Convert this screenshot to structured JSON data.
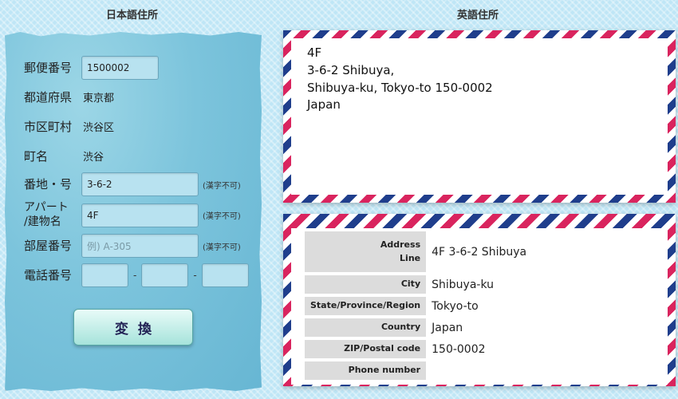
{
  "headings": {
    "japanese": "日本語住所",
    "english": "英語住所"
  },
  "form": {
    "postal_code": {
      "label": "郵便番号",
      "value": "1500002"
    },
    "prefecture": {
      "label": "都道府県",
      "value": "東京都"
    },
    "city": {
      "label": "市区町村",
      "value": "渋谷区"
    },
    "town": {
      "label": "町名",
      "value": "渋谷"
    },
    "block": {
      "label": "番地・号",
      "value": "3-6-2",
      "note": "(漢字不可)"
    },
    "building": {
      "label_line1": "アパート",
      "label_line2": "/建物名",
      "value": "4F",
      "note": "(漢字不可)"
    },
    "room": {
      "label": "部屋番号",
      "placeholder": "例) A-305",
      "note": "(漢字不可)"
    },
    "phone": {
      "label": "電話番号",
      "separator": "-"
    },
    "convert_label": "変換"
  },
  "envelope_address": [
    "4F",
    "3-6-2 Shibuya,",
    "Shibuya-ku, Tokyo-to 150-0002",
    "Japan"
  ],
  "address_table": [
    {
      "label_line1": "Address",
      "label_line2": "Line",
      "value": "4F 3-6-2 Shibuya"
    },
    {
      "label": "City",
      "value": "Shibuya-ku"
    },
    {
      "label": "State/Province/Region",
      "value": "Tokyo-to"
    },
    {
      "label": "Country",
      "value": "Japan"
    },
    {
      "label": "ZIP/Postal code",
      "value": "150-0002"
    },
    {
      "label": "Phone number",
      "value": ""
    }
  ],
  "colors": {
    "page_background": "#bfe6f6",
    "paper_panel": "#7cc4dc",
    "airmail_red": "#d9245e",
    "airmail_blue": "#1f3e8c",
    "input_background": "#b8e2f0"
  }
}
